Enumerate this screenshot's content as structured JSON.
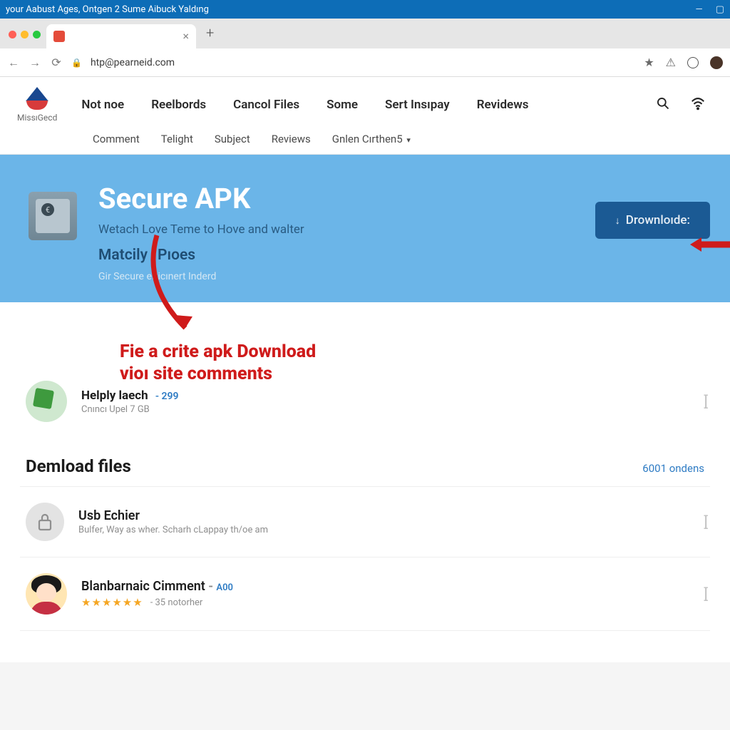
{
  "window": {
    "title": "your Aabust Ages, Ontgen 2 Sume Aibuck Yaldıng"
  },
  "browser": {
    "url": "htp@pearneid.com"
  },
  "site": {
    "brand": "MissıGecd",
    "nav_primary": [
      "Not noe",
      "Reelbords",
      "Cancol Files",
      "Some",
      "Sert Insıpay",
      "Revidews"
    ],
    "nav_secondary": [
      "Comment",
      "Telight",
      "Subject",
      "Reviews",
      "Gnlen Cırthen5"
    ]
  },
  "hero": {
    "title": "Secure APK",
    "subtitle": "Wetach Love Teme to Hove and walter",
    "meta1": "Matcily",
    "meta2": "Pıoes",
    "footer": "Gir Secure eRicınert Inderd",
    "download_label": "Drownloıde:"
  },
  "annotation": {
    "line1": "Fie a crite apk Download",
    "line2": "vioı site comments"
  },
  "helper": {
    "title": "Helply laech",
    "badge": "- 299",
    "subtitle": "Cnıncı Upel 7 GB"
  },
  "section": {
    "title": "Demload files",
    "link": "6001 ondens"
  },
  "files": [
    {
      "title": "Usb Echier",
      "subtitle": "Bulfer, Way as wher. Scharh cLappay th/oe am"
    },
    {
      "title": "Blanbarnaic Cimment",
      "badge": "A00",
      "stars": "★★★★★★",
      "rating_count": "- 35 notorher"
    }
  ]
}
